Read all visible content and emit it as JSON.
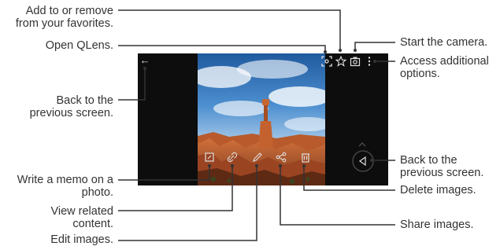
{
  "callouts": {
    "favorites": [
      "Add to or remove",
      "from your favorites."
    ],
    "qlens": [
      "Open QLens."
    ],
    "back_top": [
      "Back to the",
      "previous screen."
    ],
    "memo": [
      "Write a memo on a",
      "photo."
    ],
    "related": [
      "View related",
      "content."
    ],
    "edit": [
      "Edit images."
    ],
    "camera": [
      "Start the camera."
    ],
    "more_options": [
      "Access additional",
      "options."
    ],
    "back_bottom": [
      "Back to the",
      "previous screen."
    ],
    "delete": [
      "Delete images."
    ],
    "share": [
      "Share images."
    ]
  },
  "icons": {
    "back_arrow": "arrow-left-icon",
    "qlens": "qlens-icon",
    "favorite": "star-icon",
    "camera": "camera-icon",
    "more": "more-vertical-icon",
    "memo": "memo-icon",
    "related": "link-icon",
    "edit": "pencil-icon",
    "share": "share-icon",
    "delete": "trash-icon",
    "back_nav": "back-triangle-icon"
  },
  "colors": {
    "line": "#333333",
    "screen": "#0d0d0d",
    "icon": "#e0e0e0"
  }
}
